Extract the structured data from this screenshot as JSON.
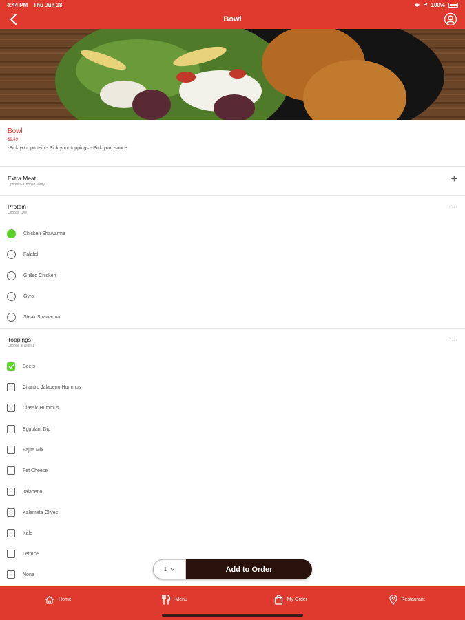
{
  "status": {
    "time": "4:44 PM",
    "date": "Thu Jun 18",
    "battery": "100%"
  },
  "nav": {
    "title": "Bowl"
  },
  "item": {
    "name": "Bowl",
    "price": "$9.49",
    "description": "-Pick your protein - Pick your toppings - Pick your sauce"
  },
  "sections": {
    "extra_meat": {
      "title": "Extra Meat",
      "subtitle": "Optional - Choose Many",
      "toggle": "+"
    },
    "protein": {
      "title": "Protein",
      "subtitle": "Choose One",
      "toggle": "−",
      "options": [
        {
          "label": "Chicken Shawarma",
          "selected": true
        },
        {
          "label": "Falafel",
          "selected": false
        },
        {
          "label": "Grilled Chicken",
          "selected": false
        },
        {
          "label": "Gyro",
          "selected": false
        },
        {
          "label": "Steak Shawarma",
          "selected": false
        }
      ]
    },
    "toppings": {
      "title": "Toppings",
      "subtitle": "Choose at least 1",
      "toggle": "−",
      "options": [
        {
          "label": "Beets",
          "checked": true
        },
        {
          "label": "Cilantro Jalapeno Hummus",
          "checked": false
        },
        {
          "label": "Classic Hummus",
          "checked": false
        },
        {
          "label": "Eggplant Dip",
          "checked": false
        },
        {
          "label": "Fajita Mix",
          "checked": false
        },
        {
          "label": "Fet Cheese",
          "checked": false
        },
        {
          "label": "Jalapeno",
          "checked": false
        },
        {
          "label": "Kalamata Olives",
          "checked": false
        },
        {
          "label": "Kale",
          "checked": false
        },
        {
          "label": "Lettuce",
          "checked": false
        },
        {
          "label": "None",
          "checked": false
        }
      ]
    }
  },
  "order": {
    "quantity": "1",
    "add_label": "Add to Order"
  },
  "tabs": [
    {
      "label": "Home",
      "icon": "home-icon"
    },
    {
      "label": "Menu",
      "icon": "fork-knife-icon"
    },
    {
      "label": "My Order",
      "icon": "bag-icon"
    },
    {
      "label": "Restaurant",
      "icon": "location-pin-icon"
    }
  ],
  "colors": {
    "brand": "#e03a2e",
    "selected": "#5ad22a",
    "order_button": "#2a120c"
  }
}
